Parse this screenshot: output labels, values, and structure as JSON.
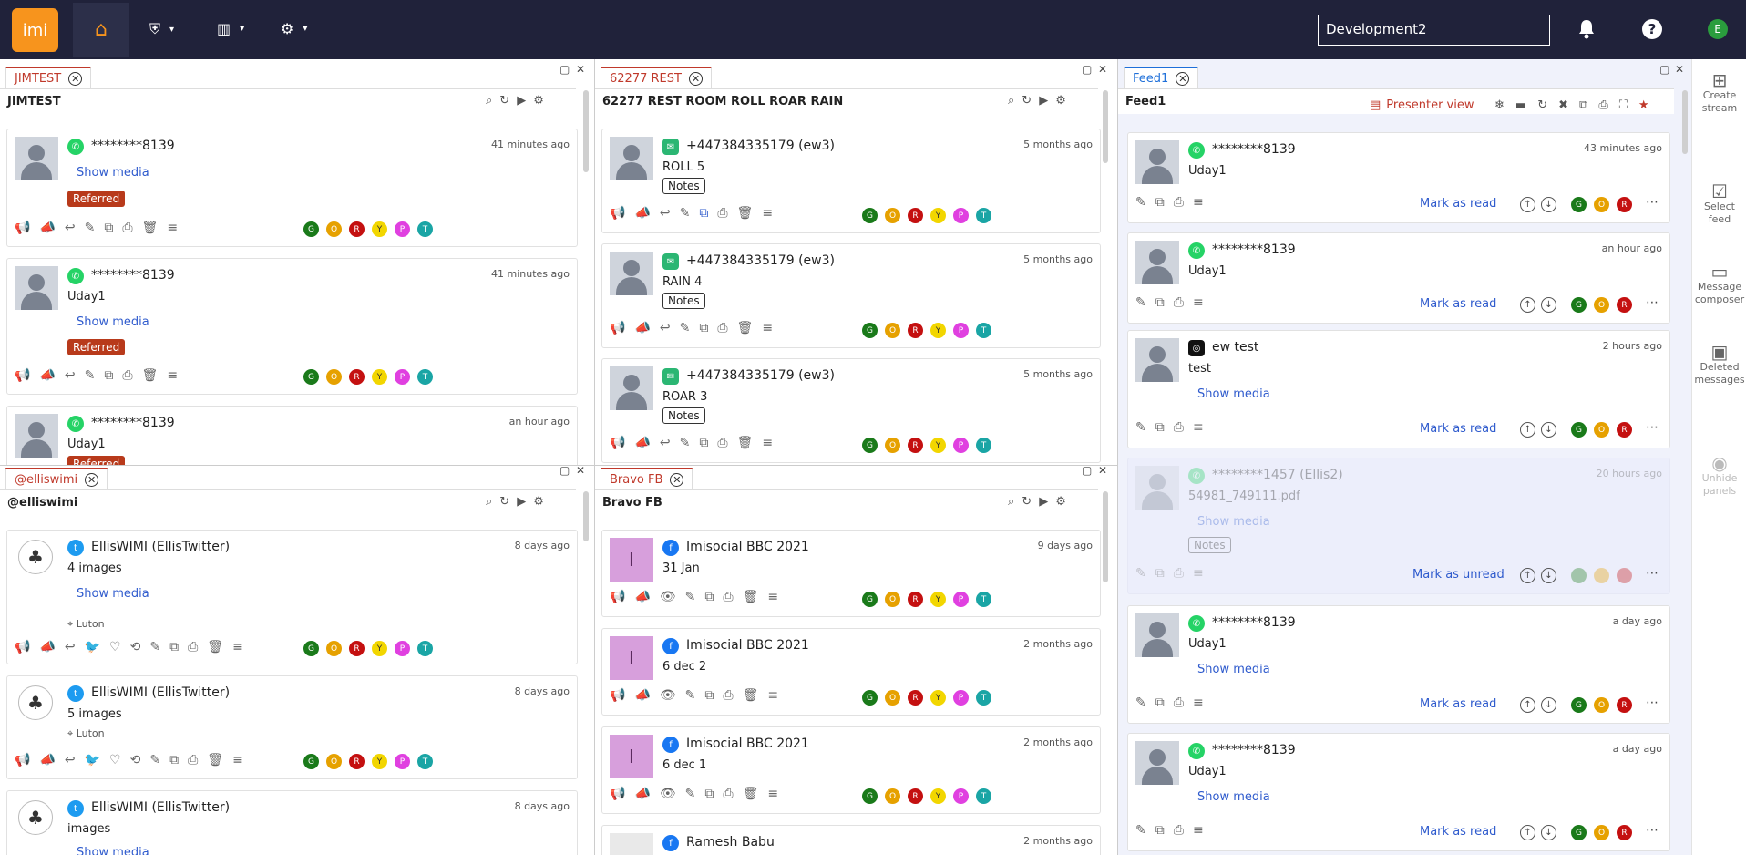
{
  "topbar": {
    "logo": "imi",
    "workspace": "Development2",
    "user_initial": "E",
    "icons": {
      "home": "home-icon",
      "shield": "shield-icon",
      "chart": "bar-chart-icon",
      "admin": "user-gear-icon",
      "bell": "bell-icon",
      "help": "help-icon"
    },
    "help_label": "?"
  },
  "sidebar": {
    "items": [
      {
        "label": "Create stream",
        "icon": "plus-grid-icon"
      },
      {
        "label": "Select feed",
        "icon": "checkbox-icon"
      },
      {
        "label": "Message composer",
        "icon": "chat-icon"
      },
      {
        "label": "Deleted messages",
        "icon": "trash-doc-icon"
      },
      {
        "label": "Unhide panels",
        "icon": "eye-icon"
      }
    ]
  },
  "tags": [
    "G",
    "O",
    "R",
    "Y",
    "P",
    "T"
  ],
  "panels": {
    "jimtest": {
      "tab": "JIMTEST",
      "title": "JIMTEST",
      "cards": [
        {
          "name": "********8139",
          "time": "41 minutes ago",
          "media": "Show media",
          "badge": "Referred"
        },
        {
          "name": "********8139",
          "time": "41 minutes ago",
          "text": "Uday1",
          "media": "Show media",
          "badge": "Referred"
        },
        {
          "name": "********8139",
          "time": "an hour ago",
          "text": "Uday1",
          "badge": "Referred"
        }
      ]
    },
    "rest": {
      "tab": "62277 REST",
      "title": "62277 REST ROOM ROLL ROAR RAIN",
      "cards": [
        {
          "name": "+447384335179 (ew3)",
          "time": "5 months ago",
          "text": "ROLL 5",
          "notes": "Notes"
        },
        {
          "name": "+447384335179 (ew3)",
          "time": "5 months ago",
          "text": "RAIN 4",
          "notes": "Notes"
        },
        {
          "name": "+447384335179 (ew3)",
          "time": "5 months ago",
          "text": "ROAR 3",
          "notes": "Notes"
        }
      ]
    },
    "elliswimi": {
      "tab": "@elliswimi",
      "title": "@elliswimi",
      "cards": [
        {
          "name": "EllisWIMI (EllisTwitter)",
          "time": "8 days ago",
          "text": "4 images",
          "media": "Show media",
          "location": "Luton"
        },
        {
          "name": "EllisWIMI (EllisTwitter)",
          "time": "8 days ago",
          "text": "5 images",
          "location": "Luton"
        },
        {
          "name": "EllisWIMI (EllisTwitter)",
          "time": "8 days ago",
          "text": "images",
          "media": "Show media"
        }
      ]
    },
    "bravo": {
      "tab": "Bravo FB",
      "title": "Bravo FB",
      "cards": [
        {
          "name": "Imisocial BBC 2021",
          "time": "9 days ago",
          "text": "31 Jan",
          "initial": "I"
        },
        {
          "name": "Imisocial BBC 2021",
          "time": "2 months ago",
          "text": "6 dec 2",
          "initial": "I"
        },
        {
          "name": "Imisocial BBC 2021",
          "time": "2 months ago",
          "text": "6 dec 1",
          "initial": "I"
        },
        {
          "name": "Ramesh Babu",
          "time": "2 months ago"
        }
      ]
    },
    "feed1": {
      "tab": "Feed1",
      "title": "Feed1",
      "presenter": "Presenter view",
      "cards": [
        {
          "name": "********8139",
          "time": "43 minutes ago",
          "text": "Uday1",
          "mark": "Mark as read"
        },
        {
          "name": "********8139",
          "time": "an hour ago",
          "text": "Uday1",
          "mark": "Mark as read"
        },
        {
          "name": "ew test",
          "time": "2 hours ago",
          "text": "test",
          "media": "Show media",
          "mark": "Mark as read"
        },
        {
          "name": "********1457 (Ellis2)",
          "time": "20 hours ago",
          "text": "54981_749111.pdf",
          "media": "Show media",
          "notes": "Notes",
          "mark": "Mark as unread"
        },
        {
          "name": "********8139",
          "time": "a day ago",
          "text": "Uday1",
          "media": "Show media",
          "mark": "Mark as read"
        },
        {
          "name": "********8139",
          "time": "a day ago",
          "text": "Uday1",
          "media": "Show media",
          "mark": "Mark as read"
        }
      ]
    }
  }
}
